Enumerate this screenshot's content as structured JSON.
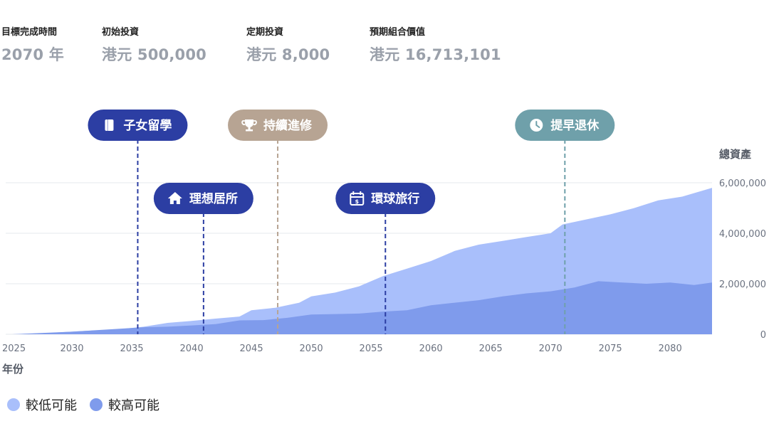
{
  "summary": [
    {
      "label": "目標完成時間",
      "value": "2070 年"
    },
    {
      "label": "初始投資",
      "value": "港元 500,000"
    },
    {
      "label": "定期投資",
      "value": "港元 8,000"
    },
    {
      "label": "預期組合價值",
      "value": "港元 16,713,101"
    }
  ],
  "chart_data": {
    "type": "area",
    "ylabel": "總資產",
    "xlabel": "年份",
    "ylim": [
      0,
      6000000
    ],
    "y_ticks": [
      {
        "value": 6000000,
        "label": "6,000,000"
      },
      {
        "value": 4000000,
        "label": "4,000,000"
      },
      {
        "value": 2000000,
        "label": "2,000,000"
      },
      {
        "value": 0,
        "label": "0"
      }
    ],
    "x_ticks": [
      2025,
      2030,
      2035,
      2040,
      2045,
      2050,
      2055,
      2060,
      2065,
      2070,
      2075,
      2080
    ],
    "xlim": [
      2025,
      2083.5
    ],
    "grid": true,
    "legend_position": "bottom-left",
    "series": [
      {
        "name": "較低可能",
        "color": "#a9bffb",
        "x": [
          2025,
          2028,
          2031,
          2034,
          2036,
          2038,
          2040,
          2042,
          2044,
          2045,
          2047,
          2049,
          2050,
          2052,
          2054,
          2056,
          2058,
          2060,
          2062,
          2064,
          2066,
          2068,
          2070,
          2071,
          2073,
          2075,
          2077,
          2079,
          2081,
          2083.5
        ],
        "upper": [
          0,
          50000,
          130000,
          200000,
          300000,
          450000,
          530000,
          620000,
          700000,
          950000,
          1050000,
          1250000,
          1500000,
          1650000,
          1900000,
          2300000,
          2600000,
          2900000,
          3300000,
          3550000,
          3700000,
          3850000,
          4000000,
          4350000,
          4550000,
          4750000,
          5000000,
          5300000,
          5450000,
          5800000
        ],
        "lower": [
          0,
          40000,
          90000,
          130000,
          150000,
          200000,
          190000,
          140000,
          110000,
          140000,
          200000,
          240000,
          230000,
          220000,
          220000,
          200000,
          220000,
          270000,
          320000,
          330000,
          330000,
          330000,
          330000,
          330000,
          330000,
          320000,
          50000,
          0,
          0,
          0
        ]
      },
      {
        "name": "較高可能",
        "color": "#7f9bec",
        "x": [
          2025,
          2030,
          2034,
          2036,
          2038,
          2040,
          2042,
          2044,
          2046,
          2048,
          2050,
          2052,
          2054,
          2056,
          2058,
          2060,
          2062,
          2064,
          2066,
          2068,
          2070,
          2072,
          2074,
          2076,
          2078,
          2080,
          2082,
          2083.5
        ],
        "upper": [
          0,
          100000,
          220000,
          280000,
          300000,
          350000,
          400000,
          550000,
          560000,
          650000,
          780000,
          800000,
          820000,
          900000,
          950000,
          1150000,
          1250000,
          1350000,
          1500000,
          1620000,
          1700000,
          1850000,
          2100000,
          2050000,
          2000000,
          2050000,
          1950000,
          2050000
        ],
        "lower": [
          0,
          0,
          0,
          0,
          0,
          0,
          0,
          0,
          0,
          0,
          0,
          0,
          0,
          0,
          0,
          0,
          0,
          0,
          0,
          0,
          0,
          0,
          0,
          0,
          0,
          0,
          0,
          0
        ]
      }
    ],
    "annotations": [
      {
        "label": "子女留學",
        "x": 2035.5,
        "icon": "book-icon",
        "color": "#2c3ea3",
        "row": 1
      },
      {
        "label": "理想居所",
        "x": 2041,
        "icon": "home-icon",
        "color": "#2c3ea3",
        "row": 2
      },
      {
        "label": "持續進修",
        "x": 2047.2,
        "icon": "trophy-icon",
        "color": "#b7a493",
        "row": 1
      },
      {
        "label": "環球旅行",
        "x": 2056.2,
        "icon": "calendar-dollar-icon",
        "color": "#2c3ea3",
        "row": 2
      },
      {
        "label": "提早退休",
        "x": 2071.2,
        "icon": "clock-icon",
        "color": "#6fa0aa",
        "row": 1
      }
    ]
  }
}
